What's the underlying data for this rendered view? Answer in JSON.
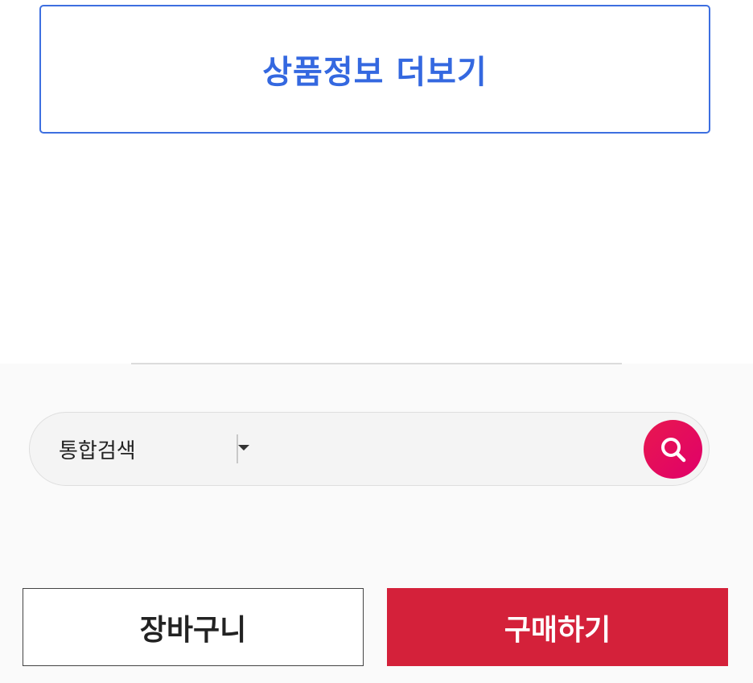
{
  "product_info": {
    "more_label": "상품정보 더보기"
  },
  "search": {
    "scope_label": "통합검색",
    "input_value": "",
    "placeholder": "",
    "button_icon": "search-icon",
    "scope_caret_icon": "caret-down-icon"
  },
  "actions": {
    "cart_label": "장바구니",
    "buy_label": "구매하기"
  },
  "colors": {
    "more_button_accent": "#3d6fe0",
    "search_button": "#e8184f",
    "buy_button": "#d4213a"
  }
}
